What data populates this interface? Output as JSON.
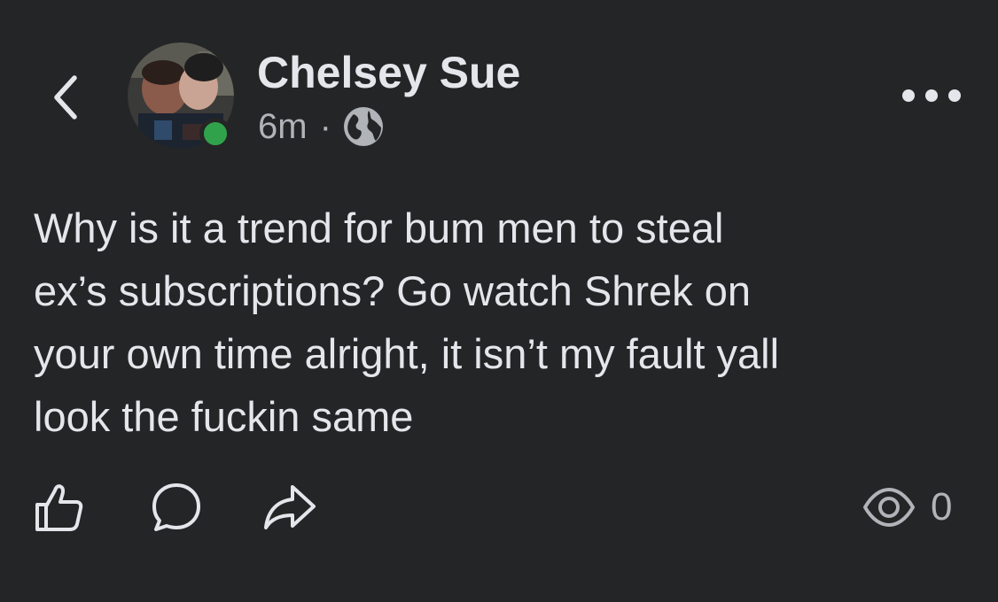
{
  "header": {
    "back_icon": "chevron-left-icon",
    "author_name": "Chelsey Sue",
    "timestamp": "6m",
    "meta_separator": "·",
    "audience_icon": "globe-icon",
    "more_icon": "more-horizontal-icon",
    "online_status_color": "#31a24c"
  },
  "post": {
    "text": "Why is it a trend for bum men to steal\nex’s subscriptions? Go watch Shrek on\nyour own time alright, it isn’t my fault yall\nlook the fuckin same"
  },
  "actions": {
    "like_icon": "thumbs-up-icon",
    "comment_icon": "comment-bubble-icon",
    "share_icon": "share-arrow-icon",
    "views_icon": "eye-icon",
    "views_count": "0"
  },
  "colors": {
    "background": "#242526",
    "primary_text": "#e4e6eb",
    "secondary_text": "#b0b3b8"
  }
}
